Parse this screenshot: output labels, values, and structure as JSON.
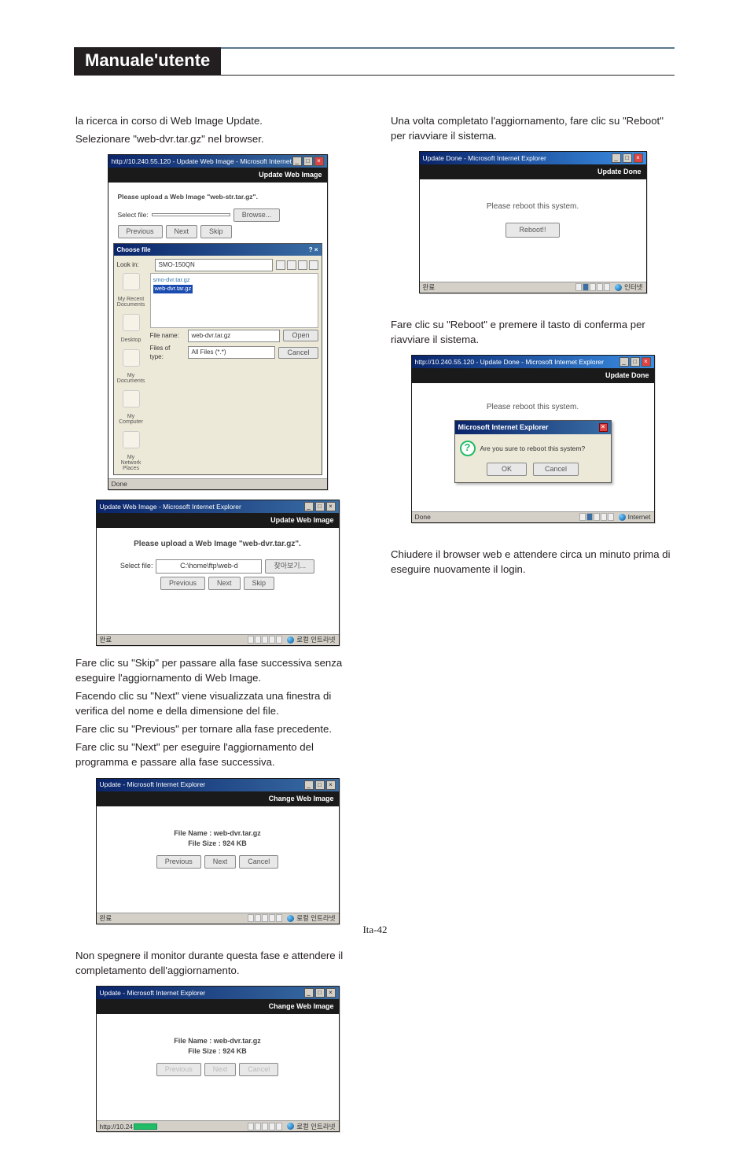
{
  "header_title": "Manuale'utente",
  "left": {
    "p1a": "la ricerca in corso di Web Image Update.",
    "p1b": "Selezionare \"web-dvr.tar.gz\" nel browser.",
    "p2a": "Fare clic su \"Skip\" per passare alla fase successiva senza eseguire l'aggiornamento di Web Image.",
    "p2b": "Facendo clic su \"Next\" viene visualizzata una finestra di verifica del nome e della dimensione del file.",
    "p2c": "Fare clic su \"Previous\" per tornare alla fase precedente.",
    "p2d": "Fare clic su \"Next\" per eseguire l'aggiornamento del programma e passare alla fase successiva.",
    "p3": "Non spegnere il monitor durante questa fase e attendere il completamento dell'aggiornamento."
  },
  "right": {
    "p1a": "Una volta completato l'aggiornamento, fare clic su \"Reboot\" per riavviare il sistema.",
    "p2": "Fare clic su \"Reboot\" e premere il tasto di conferma per riavviare il sistema.",
    "p3": "Chiudere il browser web e attendere circa un minuto prima di eseguire nuovamente il login."
  },
  "s1": {
    "title": "http://10.240.55.120 - Update Web Image - Microsoft Internet Explorer",
    "pane": "Update Web Image",
    "msg": "Please upload a Web Image \"web-str.tar.gz\".",
    "select_label": "Select file:",
    "browse": "Browse...",
    "prev": "Previous",
    "next": "Next",
    "skip": "Skip",
    "status_left": "Done",
    "od": {
      "head": "Choose file",
      "lookin_label": "Look in:",
      "lookin_value": "SMO-150QN",
      "file_a": "smo-dvr.tar.gz",
      "file_b": "web-dvr.tar.gz",
      "fn_label": "File name:",
      "fn_value": "web-dvr.tar.gz",
      "ft_label": "Files of type:",
      "ft_value": "All Files (*.*)",
      "open": "Open",
      "cancel": "Cancel",
      "icons": [
        "My Recent Documents",
        "Desktop",
        "My Documents",
        "My Computer",
        "My Network Places"
      ]
    }
  },
  "s2": {
    "title": "Update Web Image - Microsoft Internet Explorer",
    "pane": "Update Web Image",
    "msg": "Please upload a Web Image \"web-dvr.tar.gz\".",
    "select_label": "Select file:",
    "input_value": "C:\\home\\ftp\\web-d",
    "browse": "찾아보기...",
    "prev": "Previous",
    "next": "Next",
    "skip": "Skip",
    "status_left": "완료",
    "zone": "로컬 인트라넷"
  },
  "s3": {
    "title": "Update - Microsoft Internet Explorer",
    "pane": "Change Web Image",
    "fn_label": "File Name :",
    "fn_value": "web-dvr.tar.gz",
    "fs_label": "File Size :",
    "fs_value": "924 KB",
    "prev": "Previous",
    "next": "Next",
    "cancel": "Cancel",
    "status_left": "완료",
    "zone": "로컬 인트라넷"
  },
  "s4": {
    "title": "Update - Microsoft Internet Explorer",
    "pane": "Change Web Image",
    "fn_label": "File Name :",
    "fn_value": "web-dvr.tar.gz",
    "fs_label": "File Size :",
    "fs_value": "924 KB",
    "prev": "Previous",
    "next": "Next",
    "cancel": "Cancel",
    "status_left": "http://10.24",
    "zone": "로컬 인트라넷"
  },
  "s5": {
    "title": "Update Done - Microsoft Internet Explorer",
    "pane": "Update Done",
    "msg": "Please reboot this system.",
    "reboot": "Reboot!!",
    "status_left": "완료",
    "zone": "인터넷"
  },
  "s6": {
    "title": "http://10.240.55.120 - Update Done - Microsoft Internet Explorer",
    "pane": "Update Done",
    "msg": "Please reboot this system.",
    "mb_title": "Microsoft Internet Explorer",
    "mb_text": "Are you sure to reboot this system?",
    "ok": "OK",
    "cancel": "Cancel",
    "status_left": "Done",
    "zone": "Internet"
  },
  "footer": "Ita-42"
}
